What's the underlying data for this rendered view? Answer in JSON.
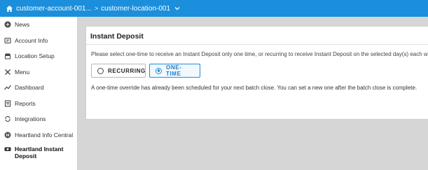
{
  "header": {
    "breadcrumb_account": "customer-account-001...",
    "breadcrumb_sep": ">",
    "breadcrumb_location": "customer-location-001"
  },
  "sidebar": {
    "items": [
      {
        "label": "News",
        "icon": "news-icon"
      },
      {
        "label": "Account Info",
        "icon": "account-icon"
      },
      {
        "label": "Location Setup",
        "icon": "store-icon"
      },
      {
        "label": "Menu",
        "icon": "utensils-icon"
      },
      {
        "label": "Dashboard",
        "icon": "chart-line-icon"
      },
      {
        "label": "Reports",
        "icon": "reports-icon"
      },
      {
        "label": "Integrations",
        "icon": "sync-icon"
      },
      {
        "label": "Heartland Info Central",
        "icon": "heartland-icon"
      },
      {
        "label": "Heartland Instant Deposit",
        "icon": "money-icon"
      }
    ]
  },
  "main": {
    "title": "Instant Deposit",
    "description": "Please select one-time to receive an Instant Deposit only one time, or recurring to receive Instant Deposit on the selected day(s) each we",
    "options": {
      "recurring": "RECURRING",
      "one_time": "ONE-TIME",
      "selected": "ONE-TIME"
    },
    "note": "A one-time override has already been scheduled for your next batch close. You can set a new one after the batch close is complete."
  },
  "colors": {
    "accent": "#1b8fdb",
    "background": "#d6d6d6"
  }
}
